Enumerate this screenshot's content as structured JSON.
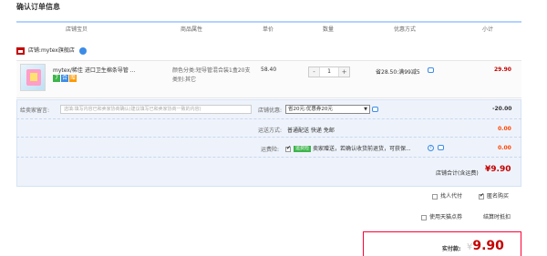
{
  "page": {
    "title": "确认订单信息"
  },
  "columns": [
    "店铺宝贝",
    "商品属性",
    "单价",
    "数量",
    "优惠方式",
    "小计"
  ],
  "shop": {
    "prefix": "店铺:",
    "name": "mytex旗舰店"
  },
  "item": {
    "title": "mytex/稀佳 进口卫生棉条导管 ...",
    "badges": [
      "7",
      "合",
      "赠"
    ],
    "attr_line1": "颜色分类:短导管混合装1盒20支",
    "attr_line2": "类别:其它",
    "unit_price": "58.40",
    "qty_minus": "-",
    "qty_value": "1",
    "qty_plus": "+",
    "discount": "省28.50:满99减5",
    "subtotal": "29.90"
  },
  "message": {
    "label": "给卖家留言:",
    "placeholder": "选填:填写内容已和卖家协商确认(建议填写已和卖家协商一致的内容)"
  },
  "shop_discount": {
    "label": "店铺优惠:",
    "selected": "省20元:优惠券20元",
    "value": "-20.00"
  },
  "shipping": {
    "label": "运送方式:",
    "value": "普通配送 快递 免邮",
    "amount": "0.00"
  },
  "insurance": {
    "label": "运费险:",
    "tag": "运费险",
    "text": "卖家赠送，若确认收货前退货，可获保...",
    "amount": "0.00"
  },
  "shop_total": {
    "label": "店铺合计(含运费)",
    "symbol": "¥",
    "amount": "9.90"
  },
  "options": {
    "proxy_pay": "找人代付",
    "anonymous": "匿名购买",
    "tmall_points": "使用天猫点券",
    "settle_discount": "结算时抵扣"
  },
  "payment": {
    "label": "实付款:",
    "symbol": "¥",
    "amount": "9.90"
  },
  "colors": {
    "accent_red": "#c40000",
    "header_line": "#b2d1ff",
    "info_bg": "#eef3fb",
    "link_blue": "#3c8ce7"
  }
}
